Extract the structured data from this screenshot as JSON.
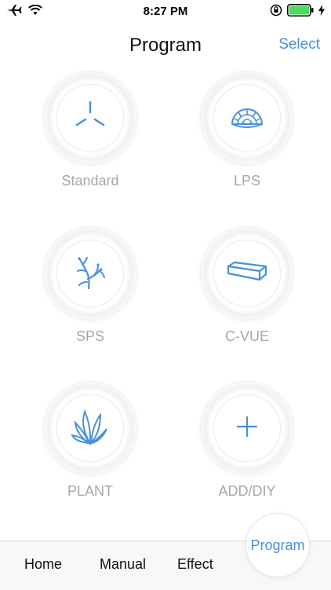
{
  "status": {
    "time": "8:27 PM",
    "icons": [
      "airplane-icon",
      "wifi-icon",
      "orientation-lock-icon",
      "battery-icon",
      "charging-bolt-icon"
    ]
  },
  "nav": {
    "title": "Program",
    "select_label": "Select"
  },
  "programs": [
    {
      "label": "Standard",
      "icon": "standard-tri-icon"
    },
    {
      "label": "LPS",
      "icon": "lps-coral-icon"
    },
    {
      "label": "SPS",
      "icon": "sps-branch-icon"
    },
    {
      "label": "C-VUE",
      "icon": "cvue-bar-icon"
    },
    {
      "label": "PLANT",
      "icon": "plant-leaves-icon"
    },
    {
      "label": "ADD/DIY",
      "icon": "plus-icon"
    }
  ],
  "tabs": {
    "home": "Home",
    "manual": "Manual",
    "effect": "Effect",
    "program": "Program"
  },
  "colors": {
    "accent": "#4a90d9",
    "label_gray": "#a7a7a7",
    "battery_green": "#4cd964"
  }
}
